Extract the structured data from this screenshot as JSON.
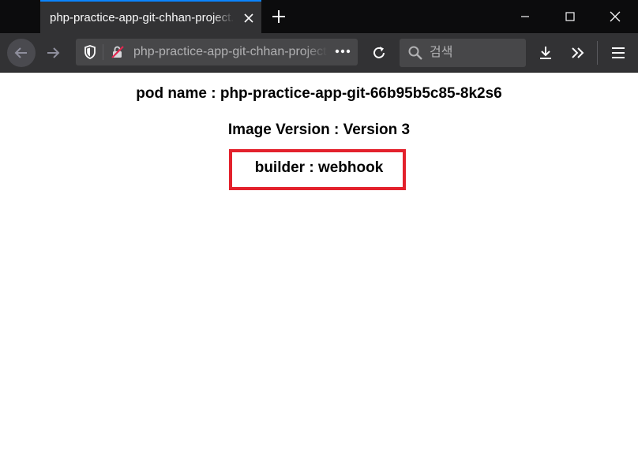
{
  "browser": {
    "tab_title": "php-practice-app-git-chhan-project.apps.example.com",
    "url_text": "php-practice-app-git-chhan-project.apps.example.com",
    "search_placeholder": "검색",
    "accent_color": "#0a84ff"
  },
  "page": {
    "pod_name_line": "pod name : php-practice-app-git-66b95b5c85-8k2s6",
    "image_version_line": "Image Version : Version 3",
    "builder_line": "builder : webhook",
    "highlight_color": "#e3212c"
  },
  "icons": [
    "close-icon",
    "plus-icon",
    "minimize-icon",
    "maximize-icon",
    "window-close-icon",
    "back-arrow-icon",
    "forward-arrow-icon",
    "shield-icon",
    "insecure-lock-icon",
    "more-icon",
    "reload-icon",
    "search-icon",
    "download-icon",
    "overflow-chevron-icon",
    "hamburger-menu-icon"
  ]
}
